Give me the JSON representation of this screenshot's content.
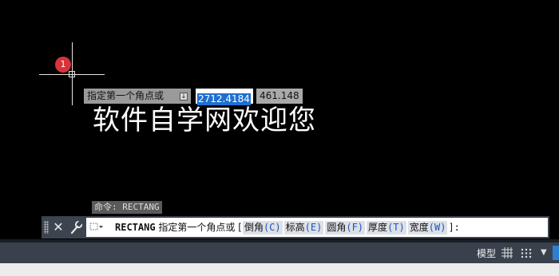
{
  "cursor": {
    "badge": "1"
  },
  "dynamic_input": {
    "prompt": "指定第一个角点或",
    "x_value": "2712.4184",
    "y_value": "461.148",
    "arrow_icon": "down-arrow-icon"
  },
  "drawing_text": "软件自学网欢迎您",
  "command_history": "命令: RECTANG",
  "command_line": {
    "command": "RECTANG",
    "prompt": "指定第一个角点或",
    "open_bracket": "[",
    "options": [
      {
        "label": "倒角",
        "key": "(C)"
      },
      {
        "label": "标高",
        "key": "(E)"
      },
      {
        "label": "圆角",
        "key": "(F)"
      },
      {
        "label": "厚度",
        "key": "(T)"
      },
      {
        "label": "宽度",
        "key": "(W)"
      }
    ],
    "close": "]:",
    "close_icon": "close-icon",
    "customize_icon": "wrench-icon"
  },
  "status_bar": {
    "model_tab": "模型",
    "grid_icon": "grid-icon",
    "snap_icon": "snap-icon"
  },
  "colors": {
    "background": "#000000",
    "badge": "#d8333a",
    "selection": "#1f6fd1",
    "option_key": "#1a55c6"
  }
}
